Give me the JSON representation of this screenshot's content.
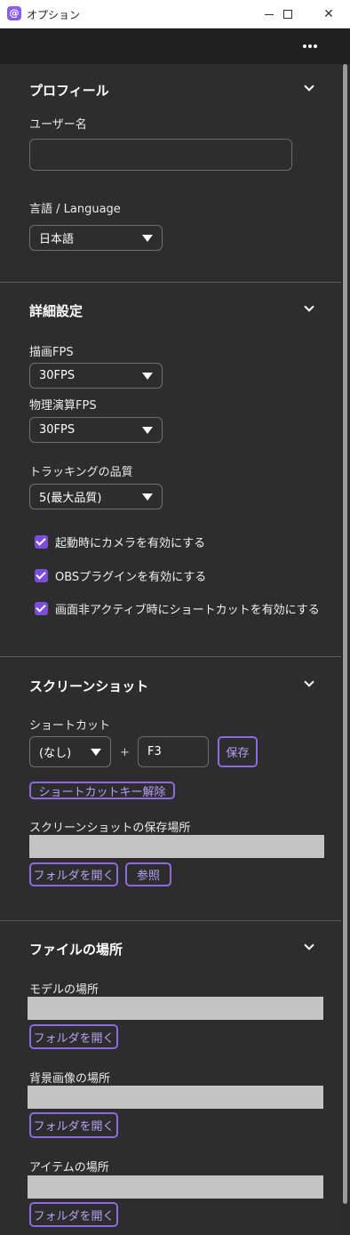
{
  "window": {
    "title": "オプション",
    "app_icon_glyph": "@",
    "controls": {
      "minimize": "minimize-icon",
      "maximize": "maximize-icon",
      "close": "close-icon",
      "close_glyph": "✕"
    }
  },
  "menubar": {
    "more_icon": "more-horizontal-icon"
  },
  "colors": {
    "accent": "#8d6ae0",
    "checkbox": "#7c4ddb",
    "background": "#2d2d2d",
    "path_field": "#c4c4c4"
  },
  "sections": {
    "profile": {
      "title": "プロフィール",
      "username_label": "ユーザー名",
      "username_value": "",
      "language_label": "言語 / Language",
      "language_value": "日本語"
    },
    "advanced": {
      "title": "詳細設定",
      "render_fps_label": "描画FPS",
      "render_fps_value": "30FPS",
      "physics_fps_label": "物理演算FPS",
      "physics_fps_value": "30FPS",
      "tracking_quality_label": "トラッキングの品質",
      "tracking_quality_value": "5(最大品質)",
      "checkboxes": [
        {
          "label": "起動時にカメラを有効にする",
          "checked": true
        },
        {
          "label": "OBSプラグインを有効にする",
          "checked": true
        },
        {
          "label": "画面非アクティブ時にショートカットを有効にする",
          "checked": true
        }
      ]
    },
    "screenshot": {
      "title": "スクリーンショット",
      "shortcut_label": "ショートカット",
      "modifier_value": "(なし)",
      "plus": "+",
      "key_value": "F3",
      "save_button": "保存",
      "clear_shortcut_button": "ショートカットキー解除",
      "save_location_label": "スクリーンショットの保存場所",
      "save_location_value": "",
      "open_folder_button": "フォルダを開く",
      "browse_button": "参照"
    },
    "file_locations": {
      "title": "ファイルの場所",
      "model_label": "モデルの場所",
      "model_value": "",
      "model_open_button": "フォルダを開く",
      "background_label": "背景画像の場所",
      "background_value": "",
      "background_open_button": "フォルダを開く",
      "item_label": "アイテムの場所",
      "item_value": "",
      "item_open_button": "フォルダを開く"
    }
  }
}
